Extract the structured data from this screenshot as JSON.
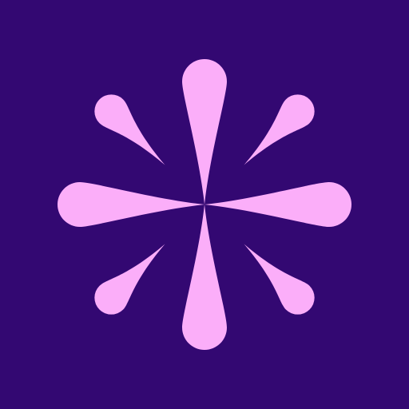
{
  "icon": {
    "name": "flower-asterisk-icon",
    "background_color": "#330872",
    "petal_color": "#FBAEF9"
  }
}
